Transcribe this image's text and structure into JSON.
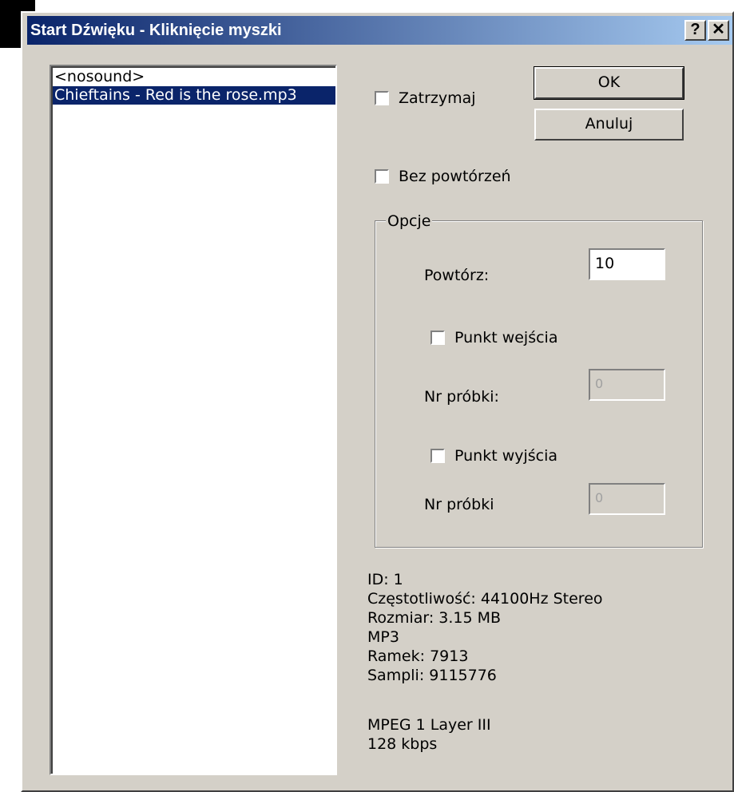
{
  "window": {
    "title": "Start Dźwięku - Kliknięcie myszki",
    "help_btn": "?",
    "close_btn": "✕"
  },
  "list": {
    "items": [
      {
        "label": "<nosound>",
        "selected": false
      },
      {
        "label": "Chieftains - Red is the rose.mp3",
        "selected": true
      }
    ]
  },
  "buttons": {
    "ok": "OK",
    "cancel": "Anuluj"
  },
  "checkboxes": {
    "stop": {
      "label": "Zatrzymaj",
      "checked": false
    },
    "no_repeat": {
      "label": "Bez powtórzeń",
      "checked": false
    },
    "in_point": {
      "label": "Punkt wejścia",
      "checked": false
    },
    "out_point": {
      "label": "Punkt wyjścia",
      "checked": false
    }
  },
  "options": {
    "legend": "Opcje",
    "repeat_label": "Powtórz:",
    "repeat_value": "10",
    "in_sample_label": "Nr próbki:",
    "in_sample_value": "0",
    "out_sample_label": "Nr próbki",
    "out_sample_value": "0"
  },
  "info": {
    "id": "ID: 1",
    "frequency": "Częstotliwość: 44100Hz Stereo",
    "size": "Rozmiar: 3.15 MB",
    "format": "MP3",
    "frames": "Ramek: 7913",
    "samples": "Sampli: 9115776",
    "mpeg": "MPEG 1 Layer III",
    "bitrate": "128 kbps"
  },
  "colors": {
    "titlebar_start": "#0a246a",
    "titlebar_end": "#a6caf0",
    "selection": "#0a246a",
    "face": "#d4d0c8"
  }
}
